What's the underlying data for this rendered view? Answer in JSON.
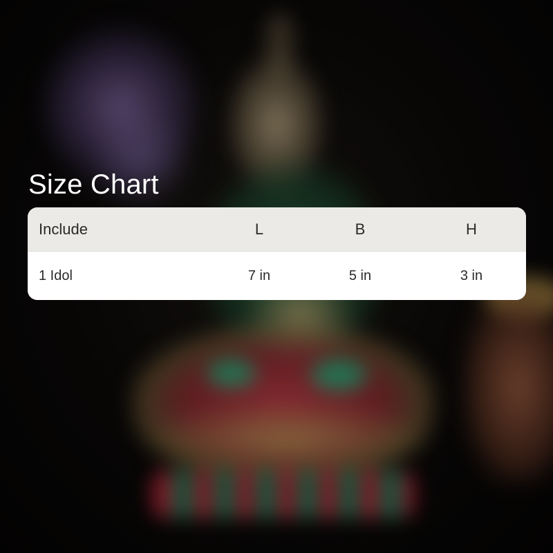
{
  "size_chart": {
    "title": "Size Chart",
    "columns": {
      "include": "Include",
      "l": "L",
      "b": "B",
      "h": "H"
    },
    "rows": [
      {
        "include": "1 Idol",
        "l": "7 in",
        "b": "5 in",
        "h": "3 in"
      }
    ]
  },
  "colors": {
    "header_bg": "#ebeae6",
    "row_bg": "#ffffff",
    "title_text": "#ffffff",
    "cell_text": "#2a2a2a"
  }
}
